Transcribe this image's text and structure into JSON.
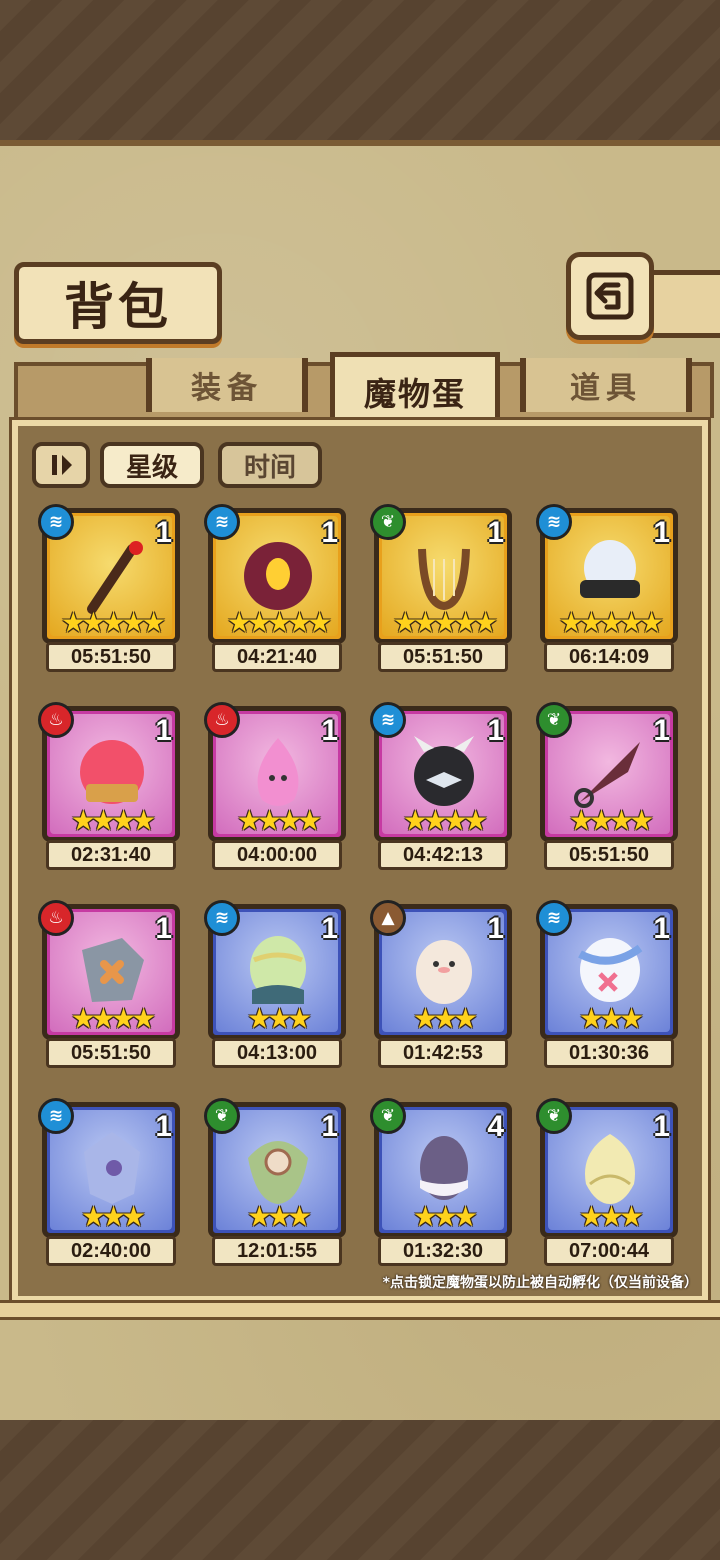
{
  "header": {
    "title": "背包",
    "back_icon": "back-arrow-icon"
  },
  "tabs": [
    {
      "label": "装备",
      "active": false
    },
    {
      "label": "魔物蛋",
      "active": true
    },
    {
      "label": "道具",
      "active": false
    }
  ],
  "sort": {
    "toggle_icon": "sort-direction-icon",
    "options": [
      "星级",
      "时间"
    ],
    "selected": "星级"
  },
  "eggs": [
    {
      "element": "water",
      "count": "1",
      "stars": 5,
      "timer": "05:51:50",
      "art": "staff"
    },
    {
      "element": "water",
      "count": "1",
      "stars": 5,
      "timer": "04:21:40",
      "art": "dark-orb"
    },
    {
      "element": "nature",
      "count": "1",
      "stars": 5,
      "timer": "05:51:50",
      "art": "lyre"
    },
    {
      "element": "water",
      "count": "1",
      "stars": 5,
      "timer": "06:14:09",
      "art": "armored-egg"
    },
    {
      "element": "fire",
      "count": "1",
      "stars": 4,
      "timer": "02:31:40",
      "art": "jelly-crown"
    },
    {
      "element": "fire",
      "count": "1",
      "stars": 4,
      "timer": "04:00:00",
      "art": "pink-flame"
    },
    {
      "element": "water",
      "count": "1",
      "stars": 4,
      "timer": "04:42:13",
      "art": "spiked-ball"
    },
    {
      "element": "nature",
      "count": "1",
      "stars": 4,
      "timer": "05:51:50",
      "art": "kunai"
    },
    {
      "element": "fire",
      "count": "1",
      "stars": 4,
      "timer": "05:51:50",
      "art": "shield"
    },
    {
      "element": "water",
      "count": "1",
      "stars": 3,
      "timer": "04:13:00",
      "art": "striped-egg"
    },
    {
      "element": "earth",
      "count": "1",
      "stars": 3,
      "timer": "01:42:53",
      "art": "fluffy"
    },
    {
      "element": "water",
      "count": "1",
      "stars": 3,
      "timer": "01:30:36",
      "art": "ribbon-egg"
    },
    {
      "element": "water",
      "count": "1",
      "stars": 3,
      "timer": "02:40:00",
      "art": "crystal"
    },
    {
      "element": "nature",
      "count": "1",
      "stars": 3,
      "timer": "12:01:55",
      "art": "seed-pod"
    },
    {
      "element": "nature",
      "count": "4",
      "stars": 3,
      "timer": "01:32:30",
      "art": "purple-egg"
    },
    {
      "element": "nature",
      "count": "1",
      "stars": 3,
      "timer": "07:00:44",
      "art": "bud-egg"
    }
  ],
  "note": "*点击锁定魔物蛋以防止被自动孵化（仅当前设备）",
  "colors": {
    "rarity5": "#e8a01c",
    "rarity4": "#c63aa2",
    "rarity3": "#3d52b8",
    "water": "#1f8fd6",
    "fire": "#d8262a",
    "nature": "#2e8e2e",
    "earth": "#8a5a32"
  }
}
